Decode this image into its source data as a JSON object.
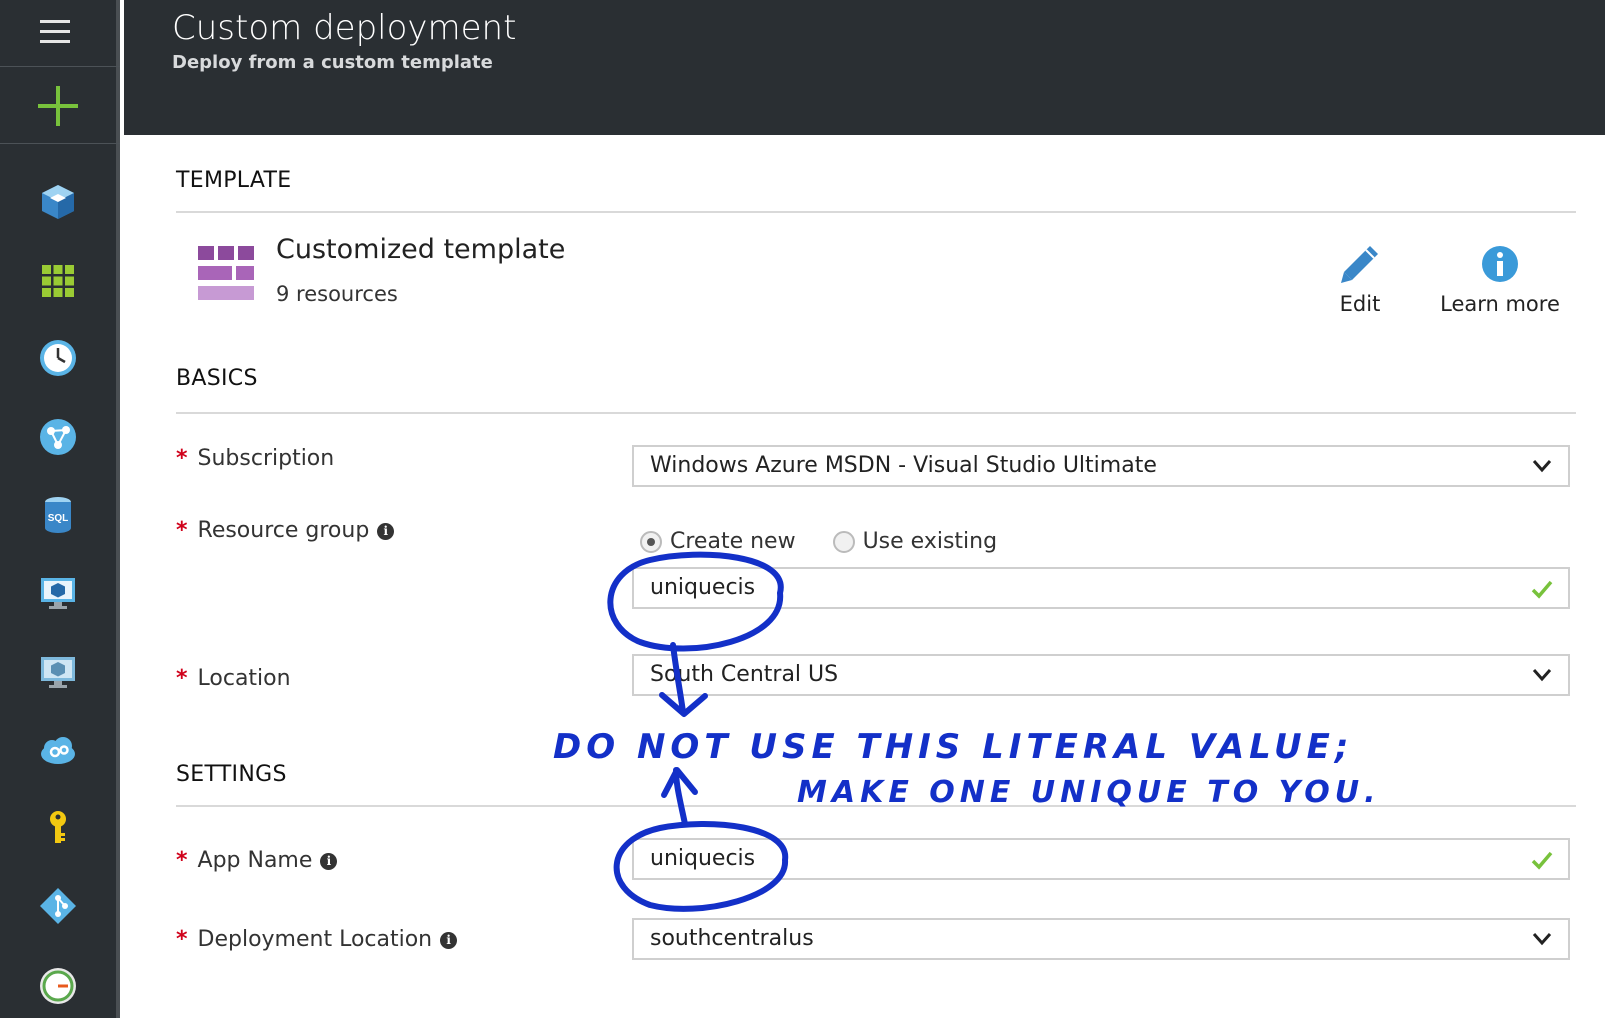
{
  "header": {
    "title": "Custom deployment",
    "subtitle": "Deploy from a custom template"
  },
  "nav": {
    "items": [
      "menu-icon",
      "new-resource-icon",
      "cube-icon",
      "grid-icon",
      "clock-icon",
      "globe-network-icon",
      "sql-database-icon",
      "virtual-machine-icon",
      "classic-vm-icon",
      "cloud-services-icon",
      "key-icon",
      "git-icon",
      "gauge-icon"
    ]
  },
  "template": {
    "section_title": "TEMPLATE",
    "name": "Customized template",
    "resources": "9 resources",
    "edit_label": "Edit",
    "learn_more_label": "Learn more"
  },
  "basics": {
    "section_title": "BASICS",
    "subscription_label": "Subscription",
    "subscription_value": "Windows Azure MSDN - Visual Studio Ultimate",
    "resource_group_label": "Resource group",
    "create_new_label": "Create new",
    "use_existing_label": "Use existing",
    "resource_group_value": "uniquecis",
    "location_label": "Location",
    "location_value": "South Central US"
  },
  "settings": {
    "section_title": "SETTINGS",
    "app_name_label": "App Name",
    "app_name_value": "uniquecis",
    "deployment_location_label": "Deployment Location",
    "deployment_location_value": "southcentralus"
  },
  "annotation": {
    "line1": "DO NOT USE THIS LITERAL VALUE;",
    "line2": "MAKE ONE UNIQUE TO YOU.",
    "color": "#1330c8"
  },
  "colors": {
    "accent_green": "#78c23c",
    "required_red": "#d0021b",
    "header_bg": "#2a2f33",
    "template_purple": "#8c4a9c"
  }
}
